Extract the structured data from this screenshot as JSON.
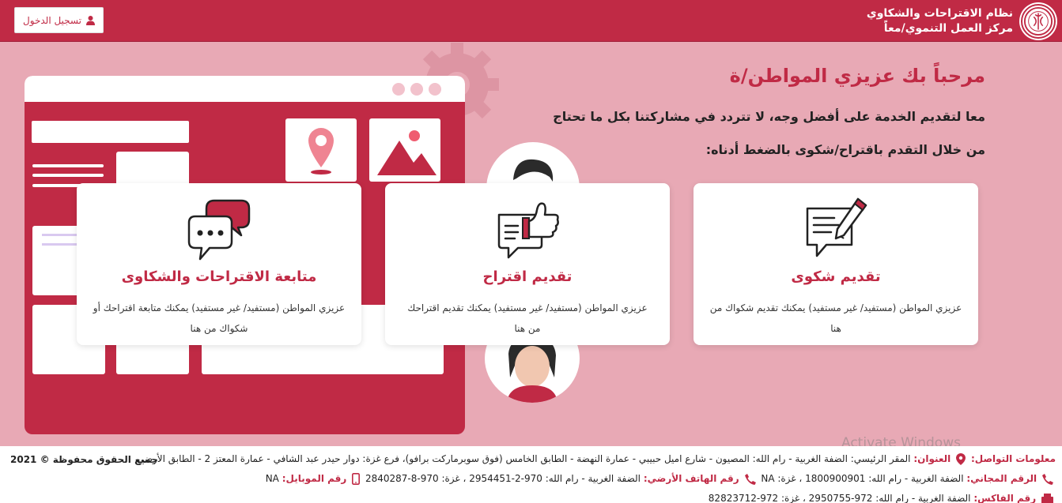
{
  "header": {
    "system_name": "نظام الاقتراحات والشكاوي",
    "org_name": "مركز العمل التنموي/معاً",
    "login_label": "تسجيل الدخول"
  },
  "hero": {
    "welcome": "مرحباً بك عزيزي المواطن/ة",
    "line1": "معا لتقديم الخدمة على أفضل وجه، لا تتردد في مشاركتنا بكل ما تحتاج",
    "line2": "من خلال التقدم باقتراح/شكوى بالضغط أدناه:"
  },
  "cards": [
    {
      "title": "تقديم شكوى",
      "desc": "عزيزي المواطن (مستفيد/ غير مستفيد) يمكنك تقديم شكواك من هنا",
      "icon": "document-pen-icon"
    },
    {
      "title": "تقديم اقتراح",
      "desc": "عزيزي المواطن (مستفيد/ غير مستفيد) يمكنك تقديم اقتراحك من هنا",
      "icon": "thumbs-up-chat-icon"
    },
    {
      "title": "متابعة الاقتراحات والشكاوى",
      "desc": "عزيزي المواطن (مستفيد/ غير مستفيد) يمكنك متابعة اقتراحك أو شكواك من هنا",
      "icon": "chat-bubbles-icon"
    }
  ],
  "footer": {
    "contact_label": "معلومات التواصل:",
    "address_label": "العنوان:",
    "address": "المقر الرئيسي: الضفة الغربية - رام الله: المصيون - شارع اميل حبيبي - عمارة النهضة - الطابق الخامس (فوق سوبرماركت برافو)، فرع غزة: دوار حيدر عبد الشافي - عمارة المعتز 2 - الطابق الأرضي",
    "tollfree_label": "الرقم المجاني:",
    "tollfree": "الضفة الغربية - رام الله: 1800900901 ، غزة: NA",
    "landline_label": "رقم الهاتف الأرضي:",
    "landline": "الضفة الغربية - رام الله: 970-2-2954451 ، غزة: 970-8-2840287",
    "mobile_label": "رقم الموبايل:",
    "mobile": "NA",
    "fax_label": "رقم الفاكس:",
    "fax": "الضفة الغربية - رام الله: 972-2950755 ، غزة: 972-82823712",
    "copyright": "جميع الحقوق محفوظة © 2021"
  },
  "watermark": "Activate Windows",
  "colors": {
    "brand": "#c02a45",
    "hero_bg": "#e8a9b5",
    "panel_light": "#f2c2cc"
  }
}
